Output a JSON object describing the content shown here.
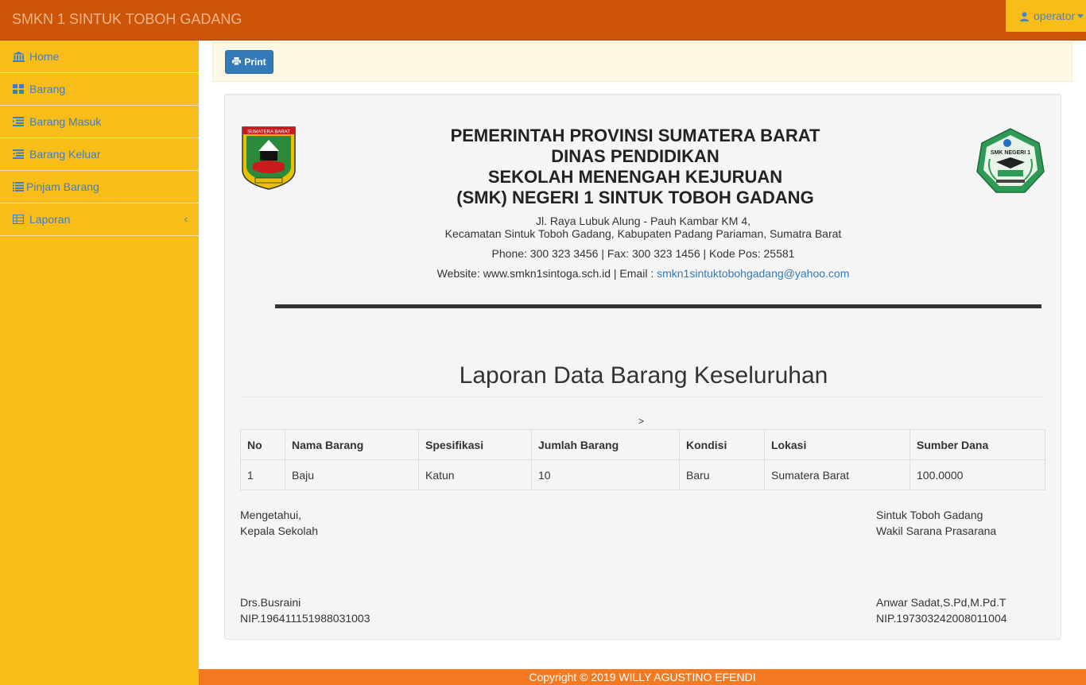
{
  "app": {
    "brand": "SMKN 1 SINTUK TOBOH GADANG"
  },
  "user_menu": {
    "label": "operator",
    "icon": "user-icon"
  },
  "sidebar": {
    "items": [
      {
        "label": "Home",
        "icon": "bank-icon"
      },
      {
        "label": "Barang",
        "icon": "grid-icon"
      },
      {
        "label": "Barang Masuk",
        "icon": "list-indent-icon"
      },
      {
        "label": "Barang Keluar",
        "icon": "list-outdent-icon"
      },
      {
        "label": "Pinjam Barang",
        "icon": "list-icon"
      },
      {
        "label": "Laporan",
        "icon": "table-icon"
      }
    ]
  },
  "toolbar": {
    "print_label": "Print",
    "print_icon": "print-icon"
  },
  "letterhead": {
    "logo_left_text": "SUMATERA BARAT",
    "logo_right_text": "SMK NEGERI 1",
    "line1": "PEMERINTAH PROVINSI SUMATERA BARAT",
    "line2": "DINAS PENDIDIKAN",
    "line3": "SEKOLAH MENENGAH KEJURUAN",
    "line4": "(SMK) NEGERI 1 SINTUK TOBOH GADANG",
    "address1": "Jl. Raya Lubuk Alung - Pauh Kambar KM 4,",
    "address2": "Kecamatan Sintuk Toboh Gadang, Kabupaten Padang Pariaman, Sumatra Barat",
    "phone": "Phone: 300 323 3456 | Fax: 300 323 1456 | Kode Pos: 25581",
    "website_prefix": "Website: www.smkn1sintoga.sch.id | Email : ",
    "email": "smkn1sintuktobohgadang@yahoo.com"
  },
  "report": {
    "title": "Laporan Data Barang Keseluruhan",
    "stray_char": ">",
    "columns": [
      "No",
      "Nama Barang",
      "Spesifikasi",
      "Jumlah Barang",
      "Kondisi",
      "Lokasi",
      "Sumber Dana"
    ],
    "rows": [
      [
        "1",
        "Baju",
        "Katun",
        "10",
        "Baru",
        "Sumatera Barat",
        "100.0000"
      ]
    ]
  },
  "signatures": {
    "left_line1": "Mengetahui,",
    "left_line2": "Kepala Sekolah",
    "left_name": "Drs.Busraini",
    "left_nip": "NIP.196411151988031003",
    "right_line1": "Sintuk Toboh Gadang",
    "right_line2": "Wakil Sarana Prasarana",
    "right_name": "Anwar Sadat,S.Pd,M.Pd.T",
    "right_nip": "NIP.197303242008011004"
  },
  "footer": {
    "text": "Copyright © 2019 WILLY AGUSTINO EFENDI"
  },
  "colors": {
    "navbar": "#cc5508",
    "sidebar": "#f9bd1a",
    "link": "#3f7fbf",
    "primary_button": "#337ab7",
    "footer": "#f47a22"
  }
}
